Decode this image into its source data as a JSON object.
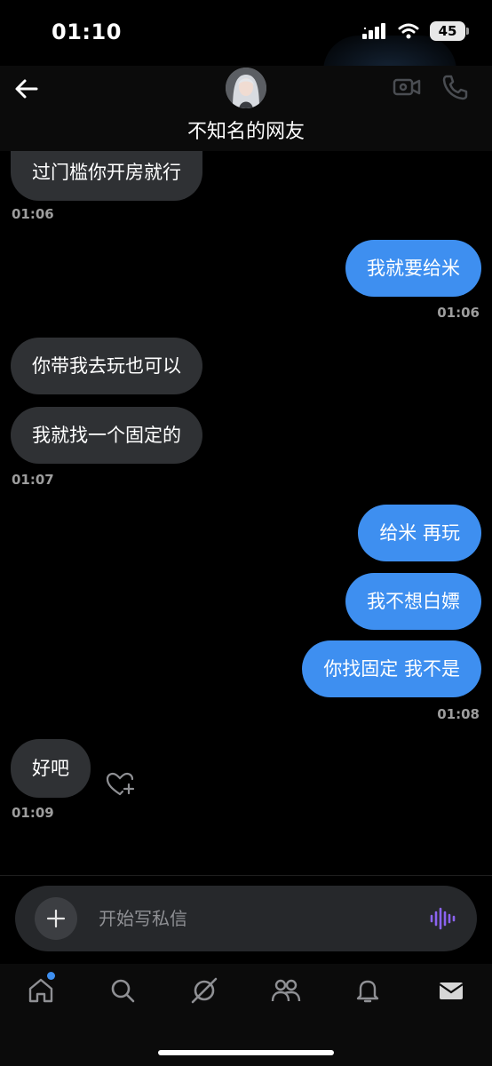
{
  "status_bar": {
    "time": "01:10",
    "battery": "45"
  },
  "header": {
    "title": "不知名的网友"
  },
  "messages": [
    {
      "direction": "in",
      "text": "过门槛你开房就行"
    },
    {
      "direction": "out",
      "text": "我就要给米"
    },
    {
      "direction": "in",
      "text": "你带我去玩也可以"
    },
    {
      "direction": "in",
      "text": "我就找一个固定的"
    },
    {
      "direction": "out",
      "text": "给米 再玩"
    },
    {
      "direction": "out",
      "text": "我不想白嫖"
    },
    {
      "direction": "out",
      "text": "你找固定 我不是"
    },
    {
      "direction": "in",
      "text": "好吧"
    }
  ],
  "timestamps": [
    "01:06",
    "01:06",
    "01:07",
    "01:08",
    "01:09"
  ],
  "composer": {
    "placeholder": "开始写私信"
  },
  "nav": [
    "home-icon",
    "search-icon",
    "explore-icon",
    "friends-icon",
    "notifications-icon",
    "messages-icon"
  ],
  "colors": {
    "outgoing_bubble": "#3e8ff0",
    "incoming_bubble": "#2f3134",
    "voice_accent": "#8b63f0",
    "background": "#000000"
  }
}
